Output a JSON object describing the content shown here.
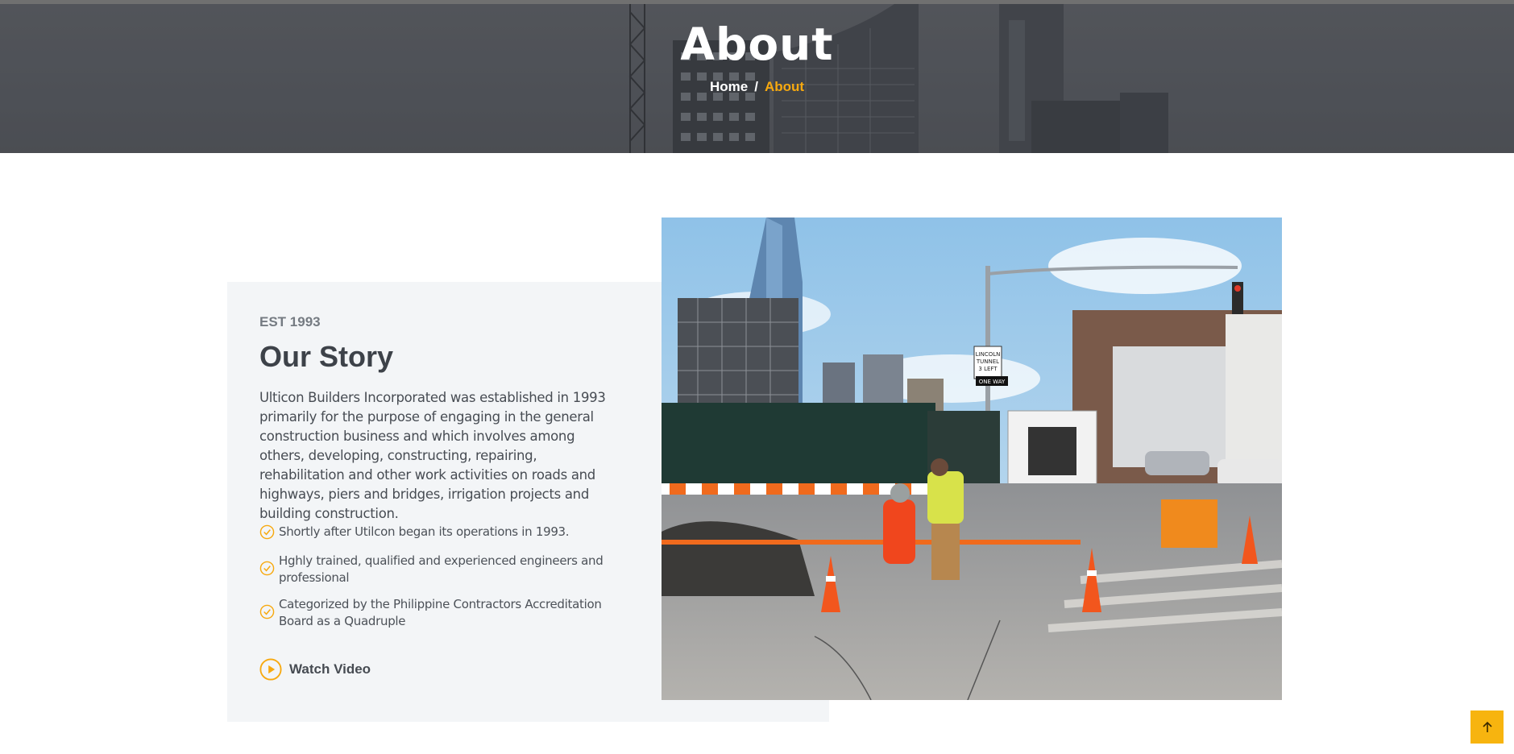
{
  "hero": {
    "title": "About",
    "breadcrumb": {
      "home": "Home",
      "separator": "/",
      "current": "About"
    }
  },
  "story": {
    "eyebrow": "EST 1993",
    "title": "Our Story",
    "body": "Ulticon Builders Incorporated was established in 1993 primarily for the purpose of engaging in the general construction business and which involves among others, developing, constructing, repairing, rehabilitation and other work activities on roads and highways, piers and bridges, irrigation projects and building construction.",
    "checklist": [
      "Shortly after Utilcon began its operations in 1993.",
      "Hghly trained, qualified and experienced engineers and professional",
      "Categorized by the Philippine Contractors Accreditation Board as a Quadruple"
    ],
    "watch_video_label": "Watch Video"
  },
  "photo": {
    "icon": "construction-photo",
    "sign_text": "LINCOLN TUNNEL 3 LEFT LANES",
    "oneway": "ONE WAY"
  },
  "colors": {
    "accent": "#f7a90f",
    "panel": "#f3f5f7",
    "hero_overlay": "#4e5157"
  },
  "icons": {
    "check": "check-circle-icon",
    "play": "play-circle-icon",
    "to_top": "arrow-up-icon"
  }
}
